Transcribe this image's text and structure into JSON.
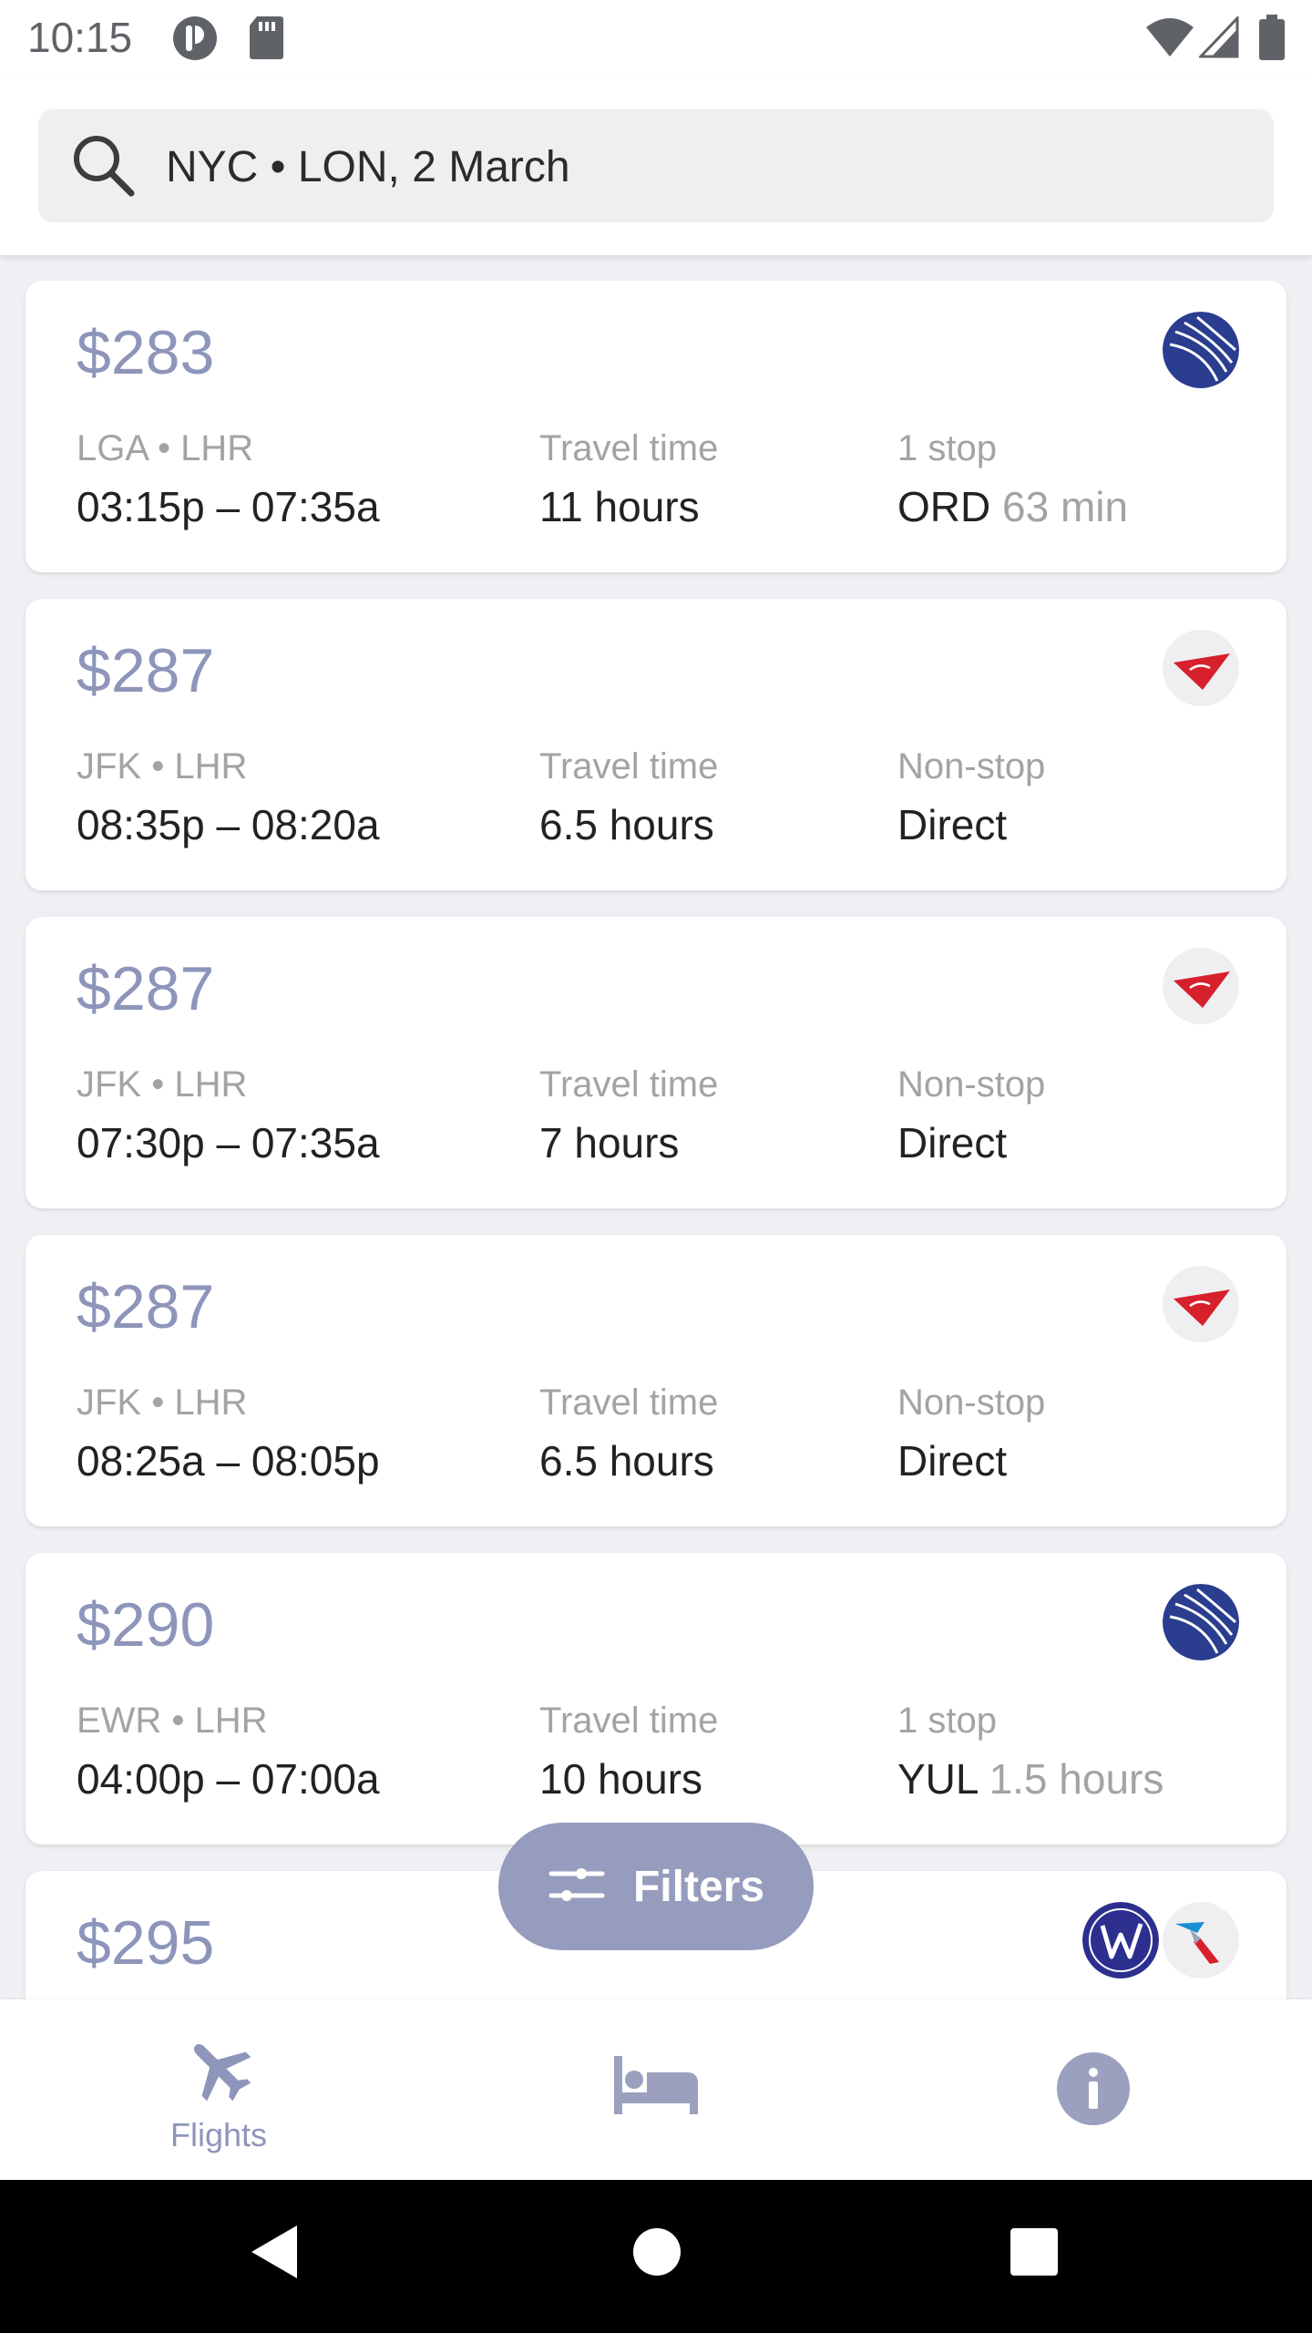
{
  "status_bar": {
    "time": "10:15",
    "left_icons": [
      "app-notification-icon",
      "sd-card-icon"
    ],
    "right_icons": [
      "wifi-icon",
      "signal-icon",
      "battery-icon"
    ]
  },
  "search": {
    "query": "NYC • LON, 2 March",
    "icon": "search-icon"
  },
  "flights": [
    {
      "price": "$283",
      "route": "LGA • LHR",
      "times": "03:15p – 07:35a",
      "travel_label": "Travel time",
      "travel_value": "11 hours",
      "stop_label": "1 stop",
      "stop_value": "ORD",
      "stop_extra": "63 min",
      "airlines": [
        "united-logo"
      ]
    },
    {
      "price": "$287",
      "route": "JFK • LHR",
      "times": "08:35p – 08:20a",
      "travel_label": "Travel time",
      "travel_value": "6.5 hours",
      "stop_label": "Non-stop",
      "stop_value": "Direct",
      "stop_extra": "",
      "airlines": [
        "virgin-logo"
      ]
    },
    {
      "price": "$287",
      "route": "JFK • LHR",
      "times": "07:30p – 07:35a",
      "travel_label": "Travel time",
      "travel_value": "7 hours",
      "stop_label": "Non-stop",
      "stop_value": "Direct",
      "stop_extra": "",
      "airlines": [
        "virgin-logo"
      ]
    },
    {
      "price": "$287",
      "route": "JFK • LHR",
      "times": "08:25a – 08:05p",
      "travel_label": "Travel time",
      "travel_value": "6.5 hours",
      "stop_label": "Non-stop",
      "stop_value": "Direct",
      "stop_extra": "",
      "airlines": [
        "virgin-logo"
      ]
    },
    {
      "price": "$290",
      "route": "EWR • LHR",
      "times": "04:00p – 07:00a",
      "travel_label": "Travel time",
      "travel_value": "10 hours",
      "stop_label": "1 stop",
      "stop_value": "YUL",
      "stop_extra": "1.5 hours",
      "airlines": [
        "united-logo"
      ]
    },
    {
      "price": "$295",
      "airlines": [
        "wow-logo",
        "american-logo"
      ]
    }
  ],
  "fab": {
    "label": "Filters",
    "icon": "filter-sliders-icon"
  },
  "bottom_nav": {
    "flights": {
      "label": "Flights",
      "icon": "airplane-icon",
      "active": true
    },
    "hotels": {
      "icon": "bed-icon"
    },
    "info": {
      "icon": "info-icon"
    }
  },
  "system_nav": [
    "back-icon",
    "home-icon",
    "recents-icon"
  ],
  "colors": {
    "accent": "#8e95ba",
    "fab": "#969cbd",
    "muted_text": "#a3a3a3",
    "background": "#eef0f3",
    "united_blue": "#2a3d8f",
    "virgin_red": "#d6202c"
  }
}
